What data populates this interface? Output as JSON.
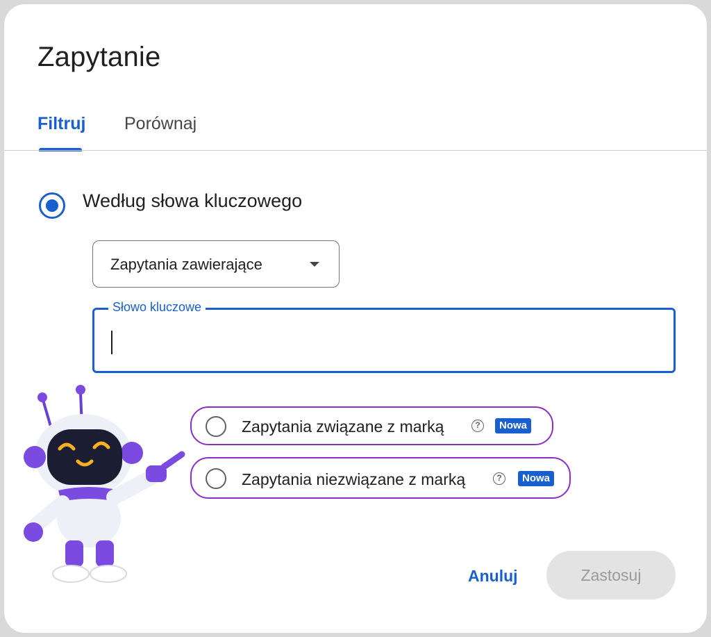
{
  "dialog": {
    "title": "Zapytanie",
    "tabs": [
      {
        "label": "Filtruj",
        "active": true
      },
      {
        "label": "Porównaj",
        "active": false
      }
    ]
  },
  "filter": {
    "keyword_option": {
      "label": "Według słowa kluczowego",
      "selected": true
    },
    "match_select": {
      "value": "Zapytania zawierające"
    },
    "keyword_field": {
      "label": "Słowo kluczowe",
      "value": ""
    },
    "brand_options": [
      {
        "label": "Zapytania związane z marką",
        "badge": "Nowa",
        "selected": false
      },
      {
        "label": "Zapytania niezwiązane z marką",
        "badge": "Nowa",
        "selected": false
      }
    ]
  },
  "actions": {
    "cancel_label": "Anuluj",
    "apply_label": "Zastosuj",
    "apply_enabled": false
  },
  "colors": {
    "accent": "#1a5fcf",
    "highlight": "#8a2fc4",
    "disabled_bg": "#e3e3e3"
  },
  "icons": {
    "help": "help-circle-icon",
    "dropdown": "caret-down-icon",
    "mascot": "robot-mascot"
  }
}
